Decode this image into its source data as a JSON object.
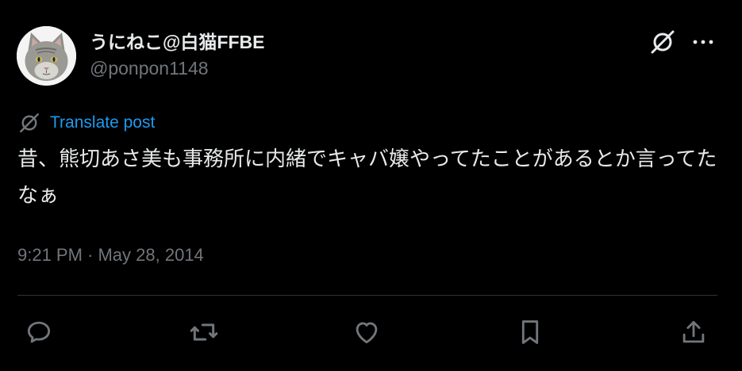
{
  "tweet": {
    "display_name": "うにねこ@白猫FFBE",
    "handle": "@ponpon1148",
    "translate_label": "Translate post",
    "text": "昔、熊切あさ美も事務所に内緒でキャバ嬢やってたことがあるとか言ってたなぁ",
    "timestamp": "9:21 PM · May 28, 2014"
  },
  "header_icons": [
    "grok-icon",
    "more-icon"
  ],
  "actions": [
    "reply-icon",
    "repost-icon",
    "like-icon",
    "bookmark-icon",
    "share-icon"
  ],
  "colors": {
    "background": "#000000",
    "primary_text": "#e7e9ea",
    "secondary_text": "#71767b",
    "link": "#1d9bf0",
    "divider": "#2f3336"
  }
}
